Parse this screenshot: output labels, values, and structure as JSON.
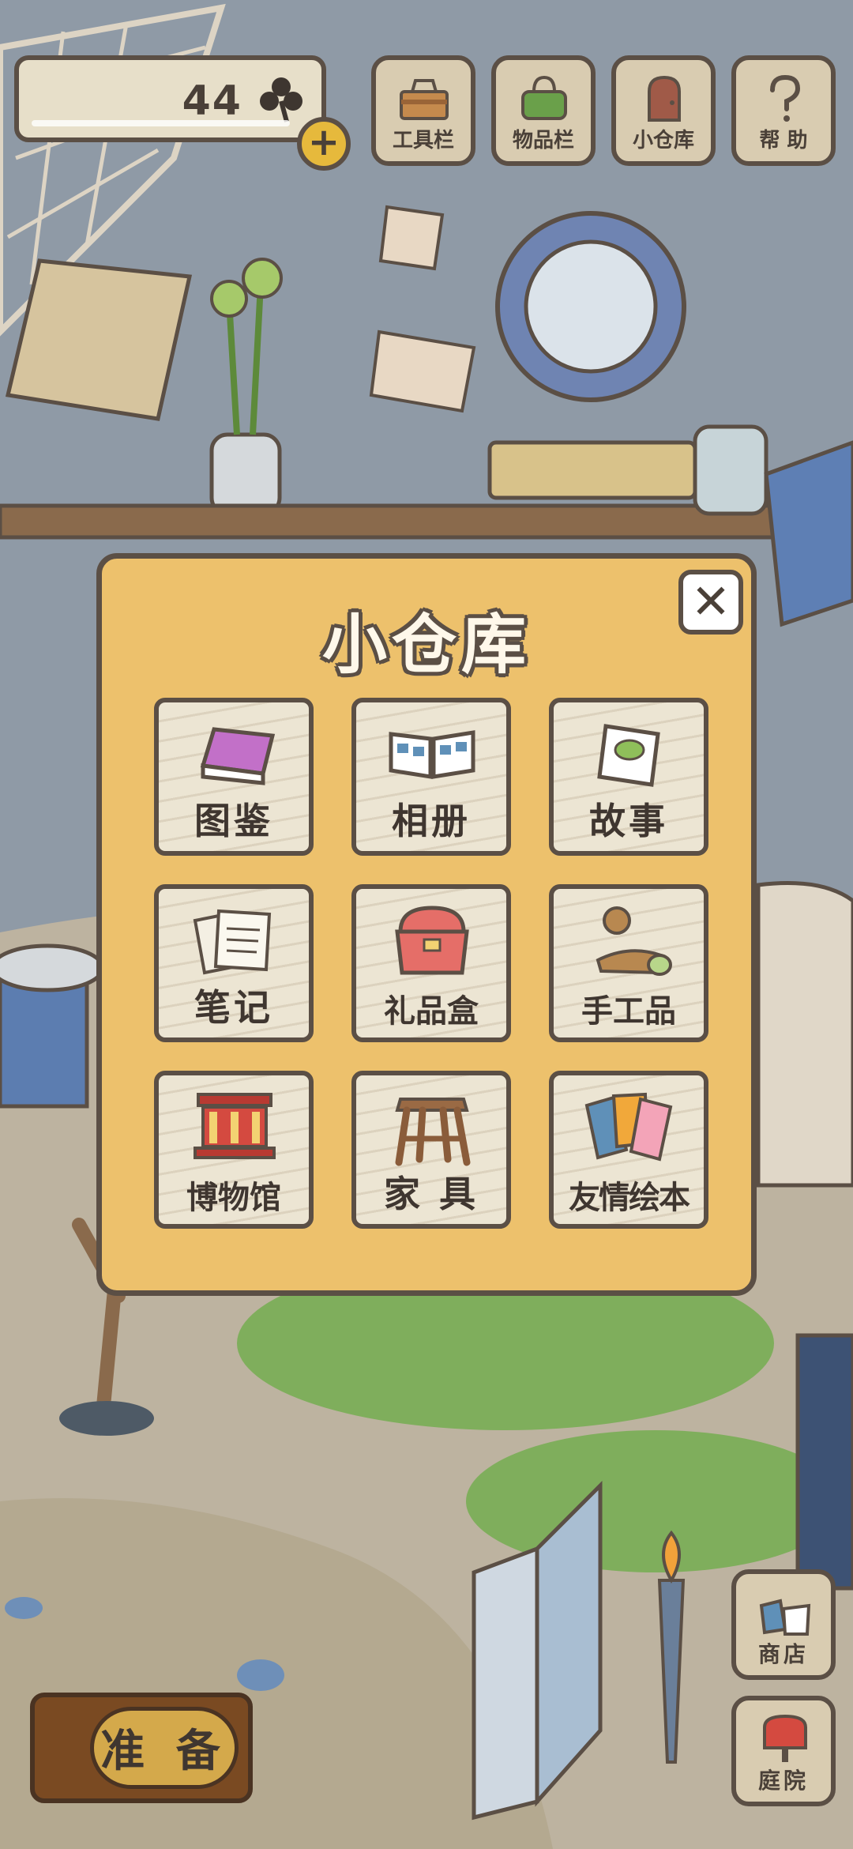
{
  "hud": {
    "clover_count": "44",
    "add_label": "+"
  },
  "toolbar": [
    {
      "label": "工具栏",
      "icon": "toolbox-icon"
    },
    {
      "label": "物品栏",
      "icon": "bag-icon"
    },
    {
      "label": "小仓库",
      "icon": "door-icon"
    },
    {
      "label": "帮 助",
      "icon": "question-icon"
    }
  ],
  "storage_panel": {
    "title": "小仓库",
    "close_label": "✕",
    "items": [
      {
        "label": "图鉴",
        "icon": "book-icon"
      },
      {
        "label": "相册",
        "icon": "album-icon"
      },
      {
        "label": "故事",
        "icon": "story-cards-icon"
      },
      {
        "label": "笔记",
        "icon": "notes-icon"
      },
      {
        "label": "礼品盒",
        "icon": "gift-chest-icon"
      },
      {
        "label": "手工品",
        "icon": "craft-icon"
      },
      {
        "label": "博物馆",
        "icon": "museum-icon"
      },
      {
        "label": "家 具",
        "icon": "stool-icon"
      },
      {
        "label": "友情绘本",
        "icon": "picture-cards-icon"
      }
    ]
  },
  "bottom": {
    "ready_label": "准 备",
    "shop_label": "商店",
    "yard_label": "庭院"
  },
  "colors": {
    "panel": "#edc16c",
    "outline": "#5b4f45",
    "tile": "#ece5d3"
  }
}
